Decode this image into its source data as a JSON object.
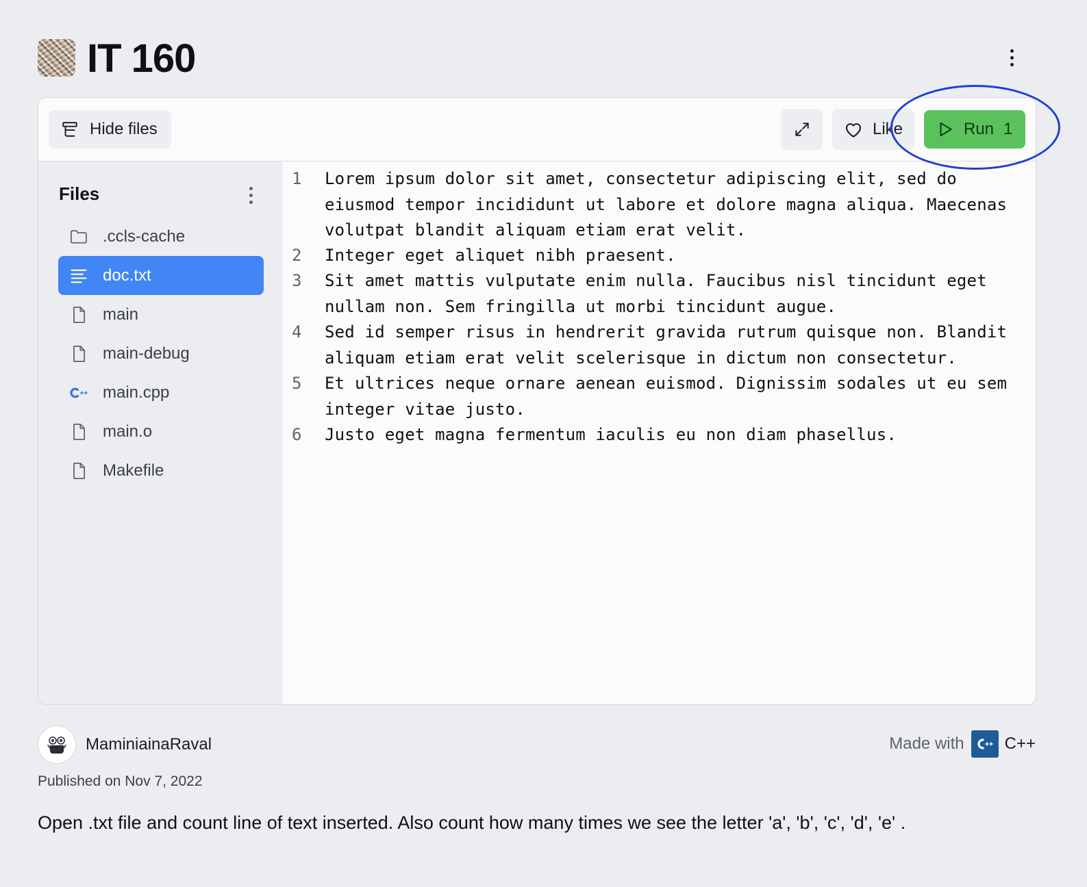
{
  "repl": {
    "title": "IT 160"
  },
  "toolbar": {
    "hide_files_label": "Hide files",
    "like_label": "Like",
    "run_label": "Run",
    "run_count": "1"
  },
  "sidebar": {
    "title": "Files",
    "files": [
      {
        "name": ".ccls-cache",
        "icon": "folder-icon",
        "active": false
      },
      {
        "name": "doc.txt",
        "icon": "text-file-icon",
        "active": true
      },
      {
        "name": "main",
        "icon": "file-icon",
        "active": false
      },
      {
        "name": "main-debug",
        "icon": "file-icon",
        "active": false
      },
      {
        "name": "main.cpp",
        "icon": "cpp-icon",
        "active": false
      },
      {
        "name": "main.o",
        "icon": "file-icon",
        "active": false
      },
      {
        "name": "Makefile",
        "icon": "file-icon",
        "active": false
      }
    ]
  },
  "editor": {
    "lines": [
      {
        "number": "1",
        "text": "Lorem ipsum dolor sit amet, consectetur adipiscing elit, sed do eiusmod tempor incididunt ut labore et dolore magna aliqua. Maecenas volutpat blandit aliquam etiam erat velit."
      },
      {
        "number": "2",
        "text": "Integer eget aliquet nibh praesent."
      },
      {
        "number": "3",
        "text": "Sit amet mattis vulputate enim nulla. Faucibus nisl tincidunt eget nullam non. Sem fringilla ut morbi tincidunt augue."
      },
      {
        "number": "4",
        "text": "Sed id semper risus in hendrerit gravida rutrum quisque non. Blandit aliquam etiam erat velit scelerisque in dictum non consectetur."
      },
      {
        "number": "5",
        "text": "Et ultrices neque ornare aenean euismod. Dignissim sodales ut eu sem integer vitae justo."
      },
      {
        "number": "6",
        "text": "Justo eget magna fermentum iaculis eu non diam phasellus."
      }
    ]
  },
  "footer": {
    "author": "MaminiainaRaval",
    "made_with_label": "Made with",
    "language": "C++",
    "published": "Published on Nov 7, 2022",
    "description": "Open .txt file and count line of text inserted. Also count how many times we see the letter 'a', 'b', 'c', 'd', 'e' ."
  },
  "colors": {
    "run_button": "#5bc15b",
    "active_file": "#4285f4",
    "annotation_circle": "#1f3fd6",
    "cpp_badge": "#1f5b99"
  }
}
